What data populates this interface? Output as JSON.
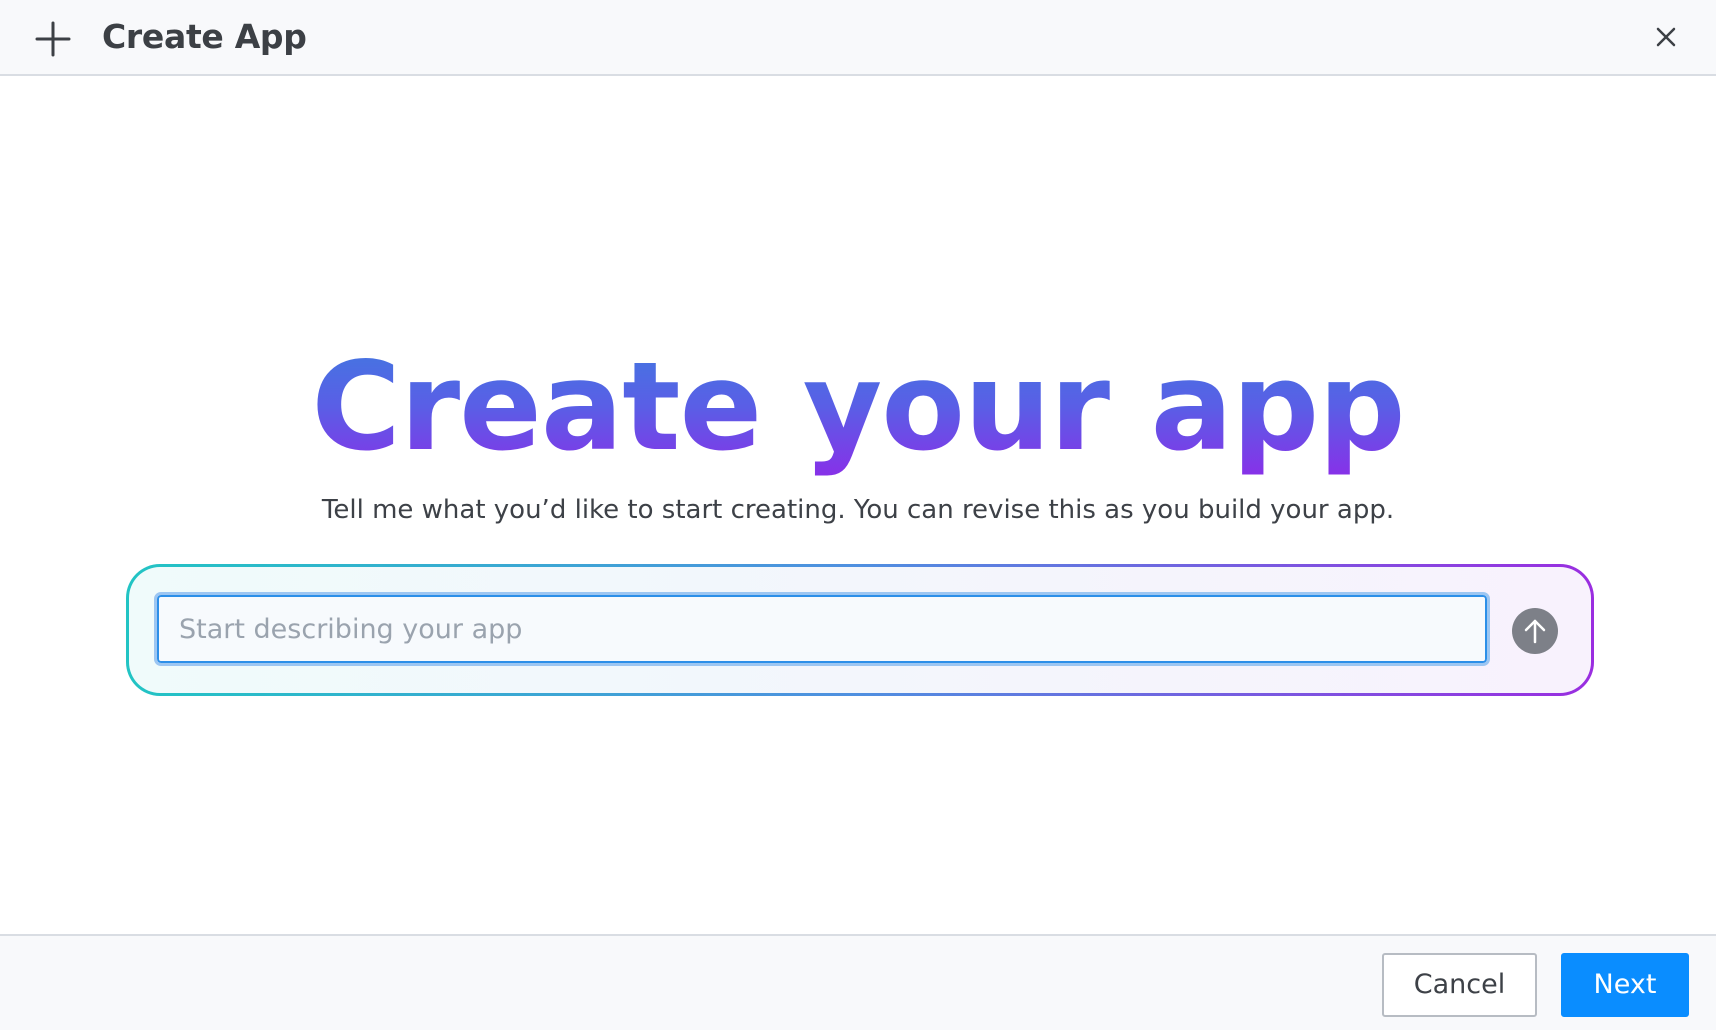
{
  "header": {
    "title": "Create App",
    "add_icon": "plus-icon",
    "close_icon": "close-icon"
  },
  "hero": {
    "title": "Create your app",
    "subtitle": "Tell me what you’d like to start creating. You can revise this as you build your app."
  },
  "prompt": {
    "placeholder": "Start describing your app",
    "value": "",
    "send_icon": "arrow-up-icon"
  },
  "footer": {
    "cancel_label": "Cancel",
    "next_label": "Next"
  },
  "colors": {
    "primary": "#0a8dff",
    "title_gradient_start": "#3f7be0",
    "title_gradient_end": "#8a2ee8",
    "prompt_border_start": "#22c4c4",
    "prompt_border_end": "#9a2de0",
    "send_button": "#7d8088"
  }
}
